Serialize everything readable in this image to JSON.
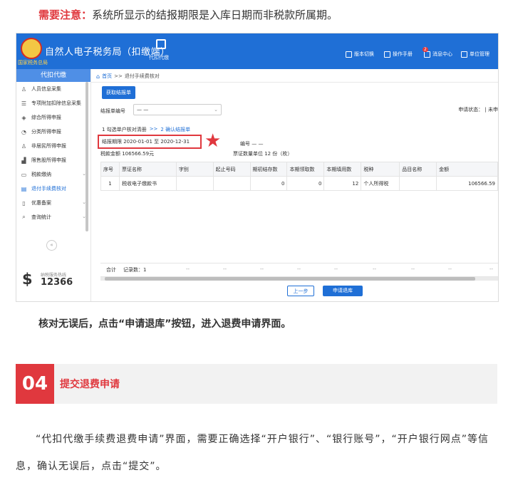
{
  "note": {
    "label": "需要注意：",
    "text": "系统所显示的结报期限是入库日期而非税款所属期。"
  },
  "app": {
    "title": "自然人电子税务局（扣缴端）",
    "emblem_caption": "国家税务总局",
    "mode_label": "代扣代缴",
    "top_nav": [
      {
        "label": "版本切换",
        "icon": "switch-icon"
      },
      {
        "label": "操作手册",
        "icon": "manual-icon"
      },
      {
        "label": "消息中心",
        "icon": "message-icon",
        "badge": "2"
      },
      {
        "label": "单位管理",
        "icon": "building-icon"
      }
    ]
  },
  "sidebar": {
    "header": "代扣代缴",
    "items": [
      {
        "label": "人员信息采集",
        "icon": "person-icon"
      },
      {
        "label": "专项附加扣除信息采集",
        "icon": "list-icon"
      },
      {
        "label": "综合所得申报",
        "icon": "layers-icon"
      },
      {
        "label": "分类所得申报",
        "icon": "pie-icon"
      },
      {
        "label": "非居民所得申报",
        "icon": "person-icon"
      },
      {
        "label": "限售股所得申报",
        "icon": "bar-chart-icon"
      },
      {
        "label": "税款缴纳",
        "icon": "calendar-icon",
        "chevron": "⌄"
      },
      {
        "label": "退付手续费核对",
        "icon": "doc-check-icon",
        "active": true
      },
      {
        "label": "优惠备案",
        "icon": "folder-icon",
        "chevron": "⌄"
      },
      {
        "label": "查询统计",
        "icon": "search-doc-icon",
        "chevron": "⌄"
      }
    ],
    "collapse": "«",
    "hotline_label": "纳税服务热线",
    "hotline_number": "12366"
  },
  "main": {
    "breadcrumb": {
      "home": "首页",
      "sep": ">>",
      "current": "退付手续费核对"
    },
    "fetch_button": "获取结报单",
    "settlement_no_label": "结报单编号",
    "settlement_no_value": "— —",
    "apply_status": "申请状态： |   未申",
    "steps": {
      "step1": "1 勾选单户核对清册",
      "sep": ">>",
      "step2": "2 确认结报单"
    },
    "period_text": "结报期限  2020-01-01  至  2020-12-31",
    "number_label": "编号   — —",
    "amount_text": "税款金额  106566.59元",
    "qty_text": "票证数量单位  12 份（枚）",
    "table": {
      "headers": [
        "序号",
        "票证名称",
        "字别",
        "起止号码",
        "期初结存数",
        "本期领取数",
        "本期填用数",
        "税种",
        "品目名称",
        "金额"
      ],
      "rows": [
        [
          "1",
          "税收电子缴款书",
          "",
          "",
          "0",
          "0",
          "12",
          "个人所得税",
          "",
          "106566.59"
        ]
      ],
      "footer_label": "合计",
      "footer_count": "记录数：1",
      "footer_dash": "--"
    },
    "prev_button": "上一步",
    "apply_button": "申请退库"
  },
  "caption": "核对无误后，点击“申请退库”按钮，进入退费申请界面。",
  "section": {
    "number": "04",
    "title": "提交退费申请"
  },
  "paragraph": "“代扣代缴手续费退费申请”界面，需要正确选择“开户银行”、“银行账号”，“开户银行网点”等信息，确认无误后，点击“提交”。",
  "colors": {
    "primary": "#1f6fd6",
    "accent_red": "#e0383e"
  }
}
